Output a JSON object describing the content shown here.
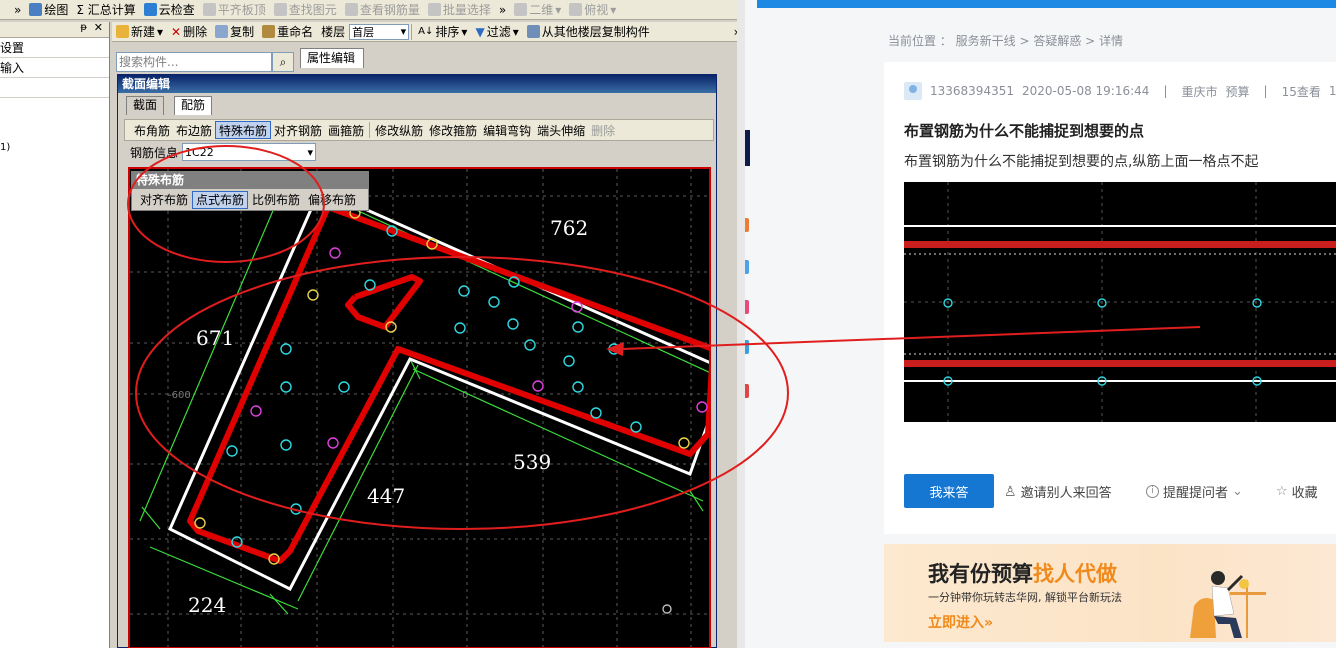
{
  "cad": {
    "toolbar1": [
      {
        "label": "»",
        "icon": "overflow-icon",
        "disabled": false
      },
      {
        "label": "绘图",
        "icon": "draw-icon",
        "disabled": false
      },
      {
        "label": "Σ 汇总计算",
        "icon": "sigma-icon",
        "disabled": false
      },
      {
        "label": "云检查",
        "icon": "cloud-check-icon",
        "disabled": false
      },
      {
        "label": "平齐板顶",
        "icon": "align-slab-icon",
        "disabled": true
      },
      {
        "label": "查找图元",
        "icon": "find-element-icon",
        "disabled": true
      },
      {
        "label": "查看钢筋量",
        "icon": "rebar-quantity-icon",
        "disabled": true
      },
      {
        "label": "批量选择",
        "icon": "batch-select-icon",
        "disabled": true
      },
      {
        "label": "»",
        "icon": "overflow-icon",
        "disabled": false
      },
      {
        "label": "二维",
        "icon": "2d-view-icon",
        "disabled": true
      },
      {
        "label": "俯视",
        "icon": "top-view-icon",
        "disabled": true
      }
    ],
    "toolbar2": {
      "new": "新建",
      "delete": "删除",
      "copy": "复制",
      "rename": "重命名",
      "floor_label": "楼层",
      "floor_value": "首层",
      "sort": "排序",
      "filter": "过滤",
      "copy_from_floor": "从其他楼层复制构件",
      "overflow": "»"
    },
    "left_pane": {
      "rows": [
        "设置",
        "输入",
        "",
        "",
        "1)"
      ]
    },
    "search_placeholder": "搜索构件...",
    "property_tab": "属性编辑",
    "dialog": {
      "title": "截面编辑",
      "tabs": [
        "截面",
        "配筋"
      ],
      "active_tab": "配筋",
      "tools": [
        "布角筋",
        "布边筋",
        "特殊布筋",
        "对齐钢筋",
        "画箍筋",
        "修改纵筋",
        "修改箍筋",
        "编辑弯钩",
        "端头伸缩",
        "删除"
      ],
      "selected_tool": "特殊布筋",
      "disabled_tool": "删除",
      "rebar_info_label": "钢筋信息",
      "rebar_info_value": "1C22",
      "popup": {
        "title": "特殊布筋",
        "buttons": [
          "对齐布筋",
          "点式布筋",
          "比例布筋",
          "偏移布筋"
        ],
        "selected": "点式布筋"
      },
      "dimensions": {
        "d762": "762",
        "d671": "671",
        "d539": "539",
        "d447": "447",
        "d224": "224",
        "coord_neg600": "-600",
        "coord_0": "0"
      }
    }
  },
  "web": {
    "breadcrumb": "当前位置 ： 服务新干线 > 答疑解惑 > 详情",
    "user": "13368394351",
    "datetime": "2020-05-08 19:16:44",
    "location": "重庆市",
    "category": "预算",
    "views": "15查看",
    "views_trunc": "1",
    "question_title": "布置钢筋为什么不能捕捉到想要的点",
    "question_body": "布置钢筋为什么不能捕捉到想要的点,纵筋上面一格点不起",
    "answer_button": "我来答",
    "invite": "邀请别人来回答",
    "remind": "提醒提问者",
    "favorite": "收藏",
    "banner": {
      "line1_a": "我有份预算",
      "line1_b": "找人代做",
      "line2": "一分钟带你玩转志华网, 解锁平台新玩法",
      "cta": "立即进入»"
    },
    "colors": {
      "accent": "#1677d2",
      "topbar": "#1e88e5",
      "banner_orange": "#f08a1c"
    }
  }
}
